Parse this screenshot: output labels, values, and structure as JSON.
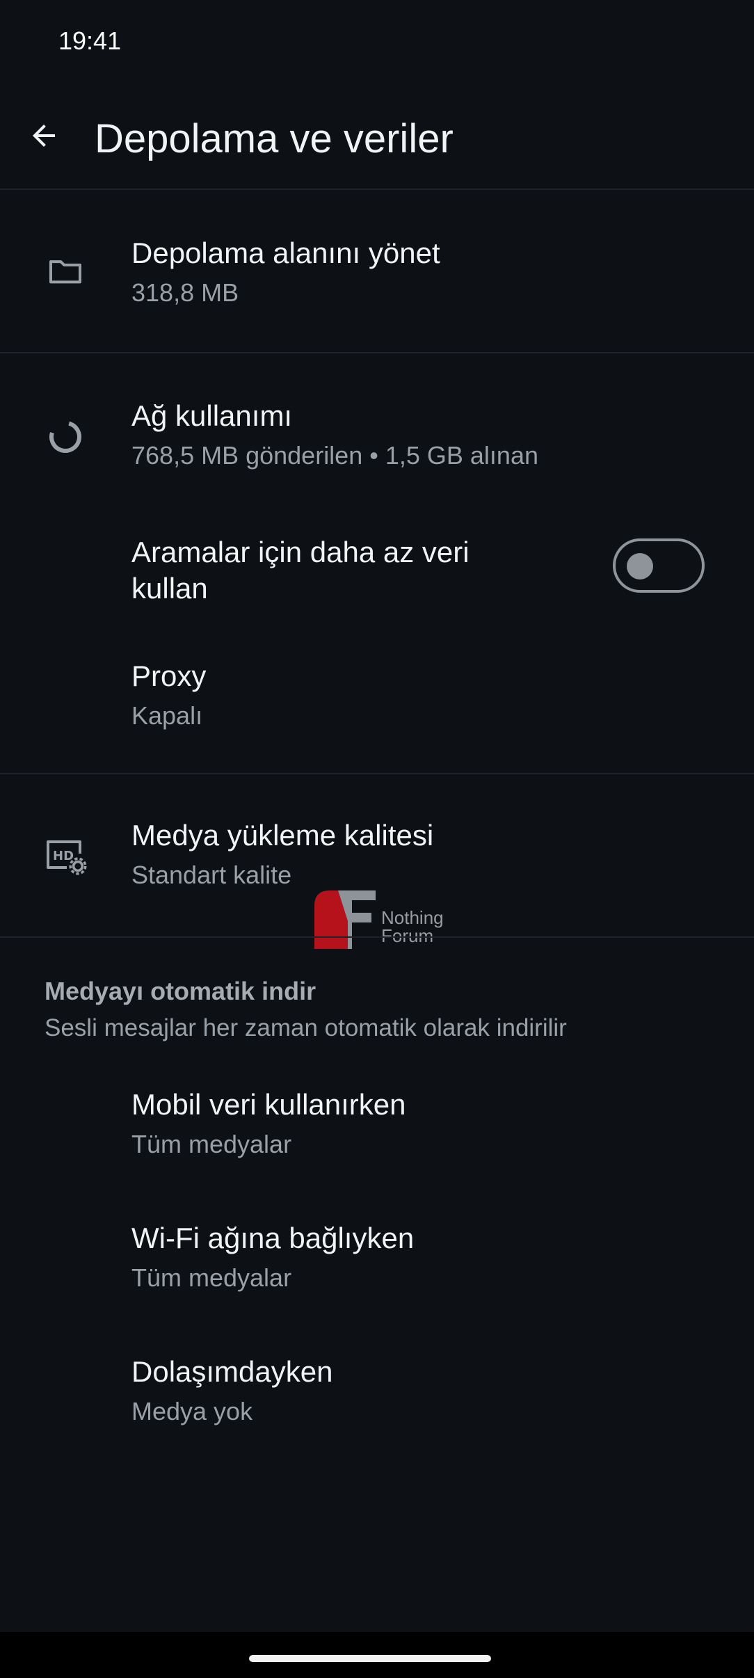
{
  "status_bar": {
    "time": "19:41"
  },
  "header": {
    "title": "Depolama ve veriler",
    "back_icon": "arrow-left-icon"
  },
  "storage": {
    "manage": {
      "title": "Depolama alanını yönet",
      "subtitle": "318,8 MB",
      "icon": "folder-icon"
    }
  },
  "network": {
    "usage": {
      "title": "Ağ kullanımı",
      "subtitle": "768,5 MB gönderilen • 1,5 GB alınan",
      "icon": "data-usage-icon"
    },
    "low_data_calls": {
      "title": "Aramalar için daha az veri kullan",
      "enabled": false
    },
    "proxy": {
      "title": "Proxy",
      "subtitle": "Kapalı"
    }
  },
  "media_quality": {
    "title": "Medya yükleme kalitesi",
    "subtitle": "Standart kalite",
    "icon": "hd-settings-icon"
  },
  "auto_download": {
    "header": "Medyayı otomatik indir",
    "subtitle": "Sesli mesajlar her zaman otomatik olarak indirilir",
    "items": [
      {
        "title": "Mobil veri kullanırken",
        "subtitle": "Tüm medyalar"
      },
      {
        "title": "Wi-Fi ağına bağlıyken",
        "subtitle": "Tüm medyalar"
      },
      {
        "title": "Dolaşımdayken",
        "subtitle": "Medya yok"
      }
    ]
  },
  "watermark": {
    "line1": "Nothing",
    "line2": "Forum"
  },
  "colors": {
    "background": "#0d1014",
    "divider": "#1f2329",
    "text_primary": "#f1f3f5",
    "text_secondary": "#9aa0a7",
    "toggle_off": "#8e949a",
    "watermark_red": "#b5121b"
  }
}
